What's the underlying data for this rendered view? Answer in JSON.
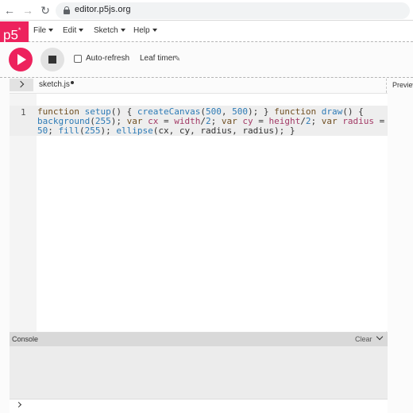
{
  "browser": {
    "url": "editor.p5js.org",
    "back_icon": "←",
    "forward_icon": "→",
    "reload_icon": "↻"
  },
  "nav": {
    "logo": "p5",
    "logo_sup": "*",
    "menus": [
      "File",
      "Edit",
      "Sketch",
      "Help"
    ]
  },
  "toolbar": {
    "auto_refresh_label": "Auto-refresh",
    "auto_refresh_checked": false,
    "sketch_name": "Leaf timer",
    "pencil_icon": "✎"
  },
  "editor": {
    "file_tab": "sketch.js",
    "preview_label": "Preview",
    "line_number": "1"
  },
  "console": {
    "title": "Console",
    "clear_label": "Clear"
  },
  "colors": {
    "brand": "#ed225d"
  }
}
